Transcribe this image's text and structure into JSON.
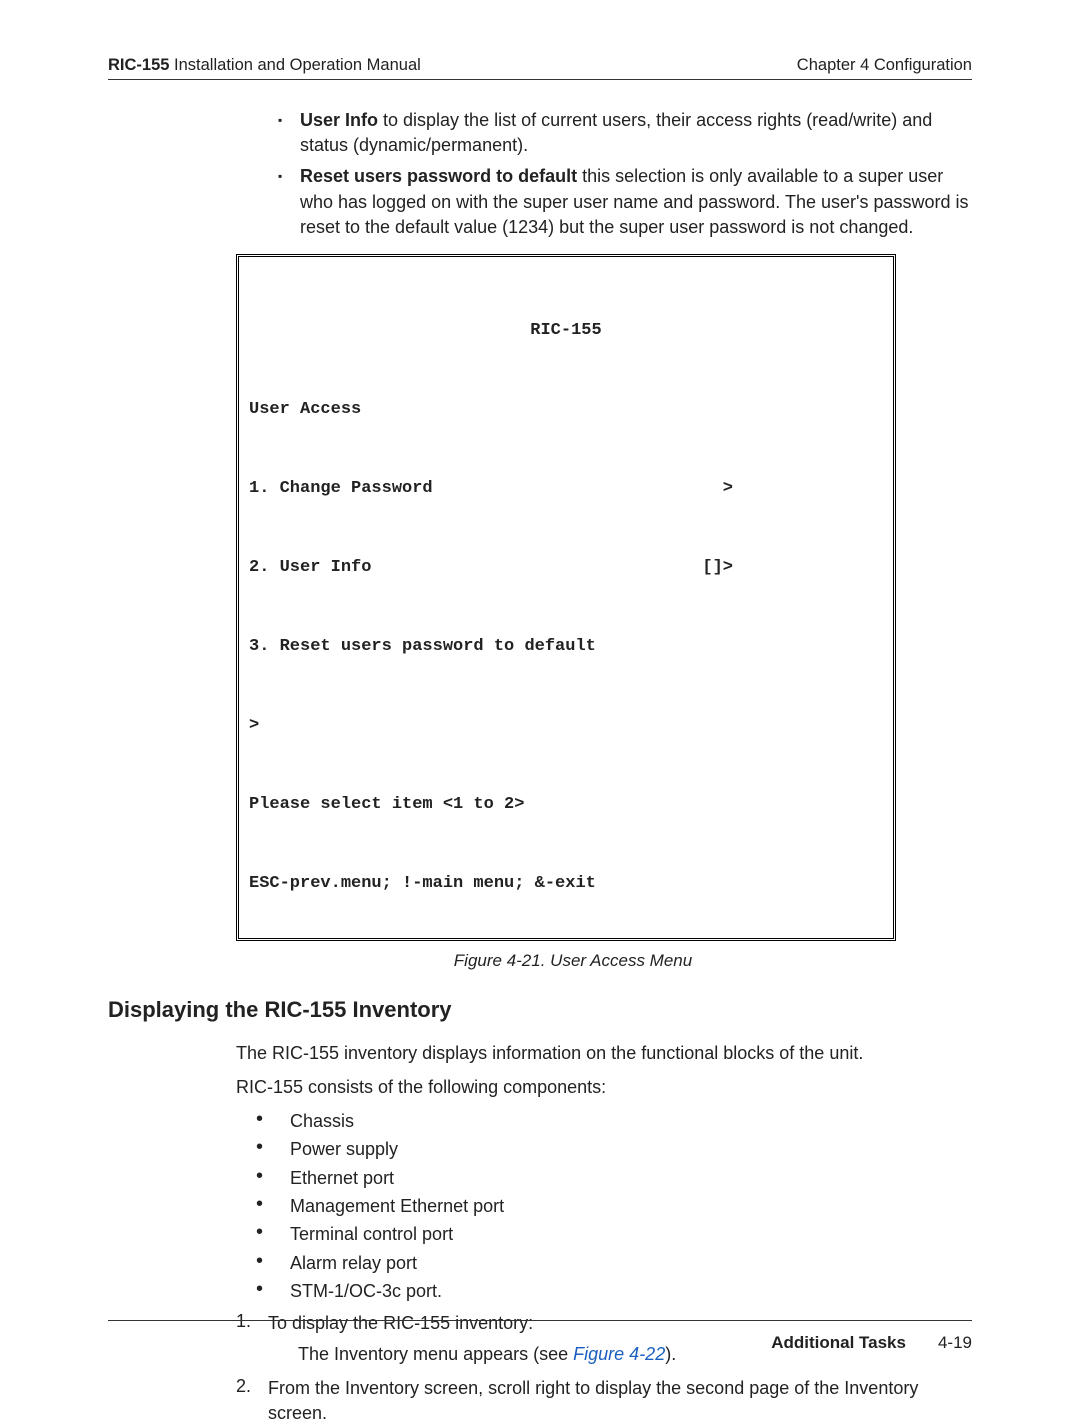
{
  "header": {
    "product": "RIC-155",
    "doc_title": " Installation and Operation Manual",
    "chapter": "Chapter 4  Configuration"
  },
  "intro_items": [
    {
      "bold": "User Info",
      "rest": " to display the list of current users, their access rights (read/write) and status (dynamic/permanent)."
    },
    {
      "bold": "Reset users password to default",
      "rest": " this selection is only available to a super user who has logged on with the super user name and password. The user's password is reset to the default value (1234) but the super user password is not changed."
    }
  ],
  "terminal": {
    "title": "RIC-155",
    "menu_title": "User Access",
    "items": [
      {
        "label": "1. Change Password",
        "marker": ">"
      },
      {
        "label": "2. User Info",
        "marker": "[]>"
      },
      {
        "label": "3. Reset users password to default",
        "marker": ""
      }
    ],
    "prompt": ">",
    "select_line": "Please select item <1 to 2>",
    "nav_line": "ESC-prev.menu; !-main menu; &-exit"
  },
  "figure_caption": "Figure 4-21.  User Access Menu",
  "section_heading": "Displaying the RIC-155 Inventory",
  "section_para1": "The RIC-155 inventory displays information on the functional blocks of the unit.",
  "section_para2": "RIC-155 consists of the following components:",
  "components": [
    "Chassis",
    "Power supply",
    "Ethernet port",
    "Management Ethernet port",
    "Terminal control port",
    "Alarm relay port",
    "STM-1/OC-3c port."
  ],
  "steps": {
    "s1": "To display the RIC-155 inventory:",
    "s1_sub_pre": "The Inventory menu appears (see ",
    "s1_sub_ref": "Figure 4-22",
    "s1_sub_post": ").",
    "s2": "From the Inventory screen, scroll right to display the second page of the Inventory screen."
  },
  "footer": {
    "section_title": "Additional Tasks",
    "page_num": "4-19"
  }
}
